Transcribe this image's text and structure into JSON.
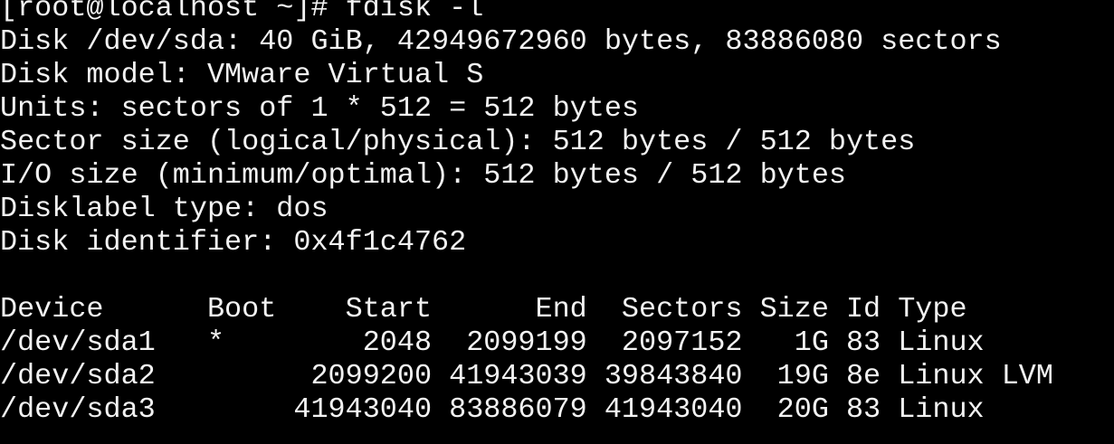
{
  "terminal": {
    "prompt_line": "[root@localhost ~]# fdisk -l",
    "disk_info": [
      "Disk /dev/sda: 40 GiB, 42949672960 bytes, 83886080 sectors",
      "Disk model: VMware Virtual S",
      "Units: sectors of 1 * 512 = 512 bytes",
      "Sector size (logical/physical): 512 bytes / 512 bytes",
      "I/O size (minimum/optimal): 512 bytes / 512 bytes",
      "Disklabel type: dos",
      "Disk identifier: 0x4f1c4762"
    ],
    "partition_table": {
      "header": "Device      Boot    Start      End  Sectors Size Id Type",
      "rows": [
        "/dev/sda1   *        2048  2099199  2097152   1G 83 Linux",
        "/dev/sda2         2099200 41943039 39843840  19G 8e Linux LVM",
        "/dev/sda3        41943040 83886079 41943040  20G 83 Linux"
      ]
    }
  }
}
